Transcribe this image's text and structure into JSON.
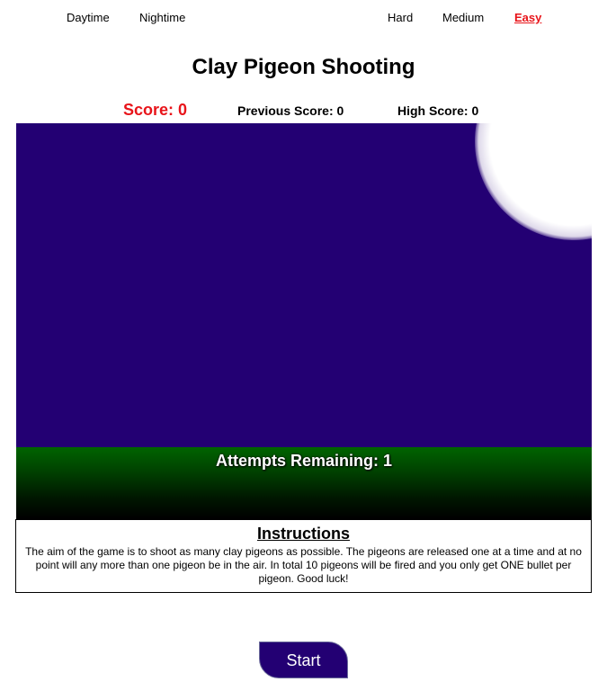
{
  "nav": {
    "daytime": "Daytime",
    "nighttime": "Nightime",
    "hard": "Hard",
    "medium": "Medium",
    "easy": "Easy",
    "selected_difficulty": "Easy",
    "selected_color": "#e8141a"
  },
  "title": "Clay Pigeon Shooting",
  "scores": {
    "current": "Score: 0",
    "previous": "Previous Score: 0",
    "high": "High Score: 0"
  },
  "game": {
    "sky_color": "#230073",
    "ground_color": "#006400",
    "moon_icon": "moon-icon",
    "attempts": "Attempts Remaining: 1"
  },
  "instructions": {
    "heading": "Instructions",
    "text": "The aim of the game is to shoot as many clay pigeons as possible. The pigeons are released one at a time and at no point will any more than one pigeon be in the air. In total 10 pigeons will be fired and you only get ONE bullet per pigeon. Good luck!"
  },
  "start_label": "Start"
}
